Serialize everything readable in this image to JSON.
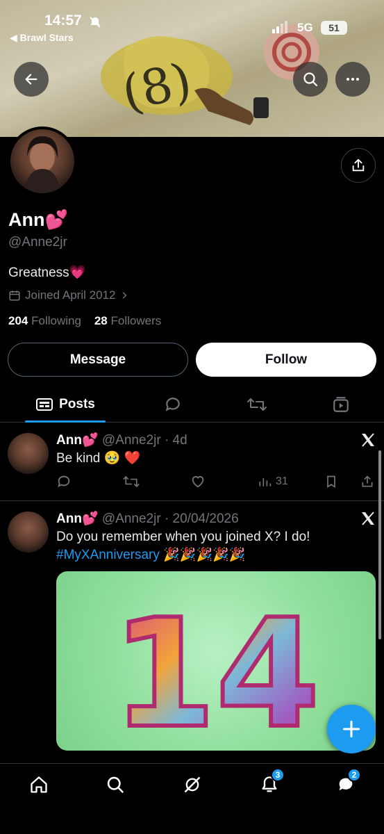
{
  "status_bar": {
    "time": "14:57",
    "back_app": "◀ Brawl Stars",
    "network": "5G",
    "battery": "51"
  },
  "profile": {
    "name": "Ann",
    "name_emoji": "💕",
    "handle": "@Anne2jr",
    "bio": "Greatness",
    "bio_emoji": "💗",
    "joined": "Joined April 2012",
    "following_count": "204",
    "following_label": "Following",
    "followers_count": "28",
    "followers_label": "Followers"
  },
  "actions": {
    "message_label": "Message",
    "follow_label": "Follow"
  },
  "tabs": {
    "posts_label": "Posts"
  },
  "posts": [
    {
      "name": "Ann",
      "name_emoji": "💕",
      "meta": "@Anne2jr · 4d",
      "text": "Be kind 🥹 ❤️",
      "views": "31"
    },
    {
      "name": "Ann",
      "name_emoji": "💕",
      "meta": "@Anne2jr · 20/04/2026",
      "text": "Do you remember when you joined X? I do!",
      "hashtag": "#MyXAnniversary",
      "emojis": "🎉🎉🎉🎉🎉",
      "media_number": "14"
    }
  ],
  "bottom_nav": {
    "notifications_badge": "3",
    "messages_badge": "2"
  },
  "colors": {
    "accent": "#1d9bf0",
    "background": "#000000",
    "muted_text": "#71767b"
  },
  "icons": [
    "back-arrow-icon",
    "search-icon",
    "more-icon",
    "share-icon",
    "calendar-icon",
    "chevron-right-icon",
    "posts-icon",
    "replies-icon",
    "reposts-icon",
    "media-icon",
    "x-logo-icon",
    "reply-icon",
    "repost-icon",
    "like-icon",
    "views-icon",
    "bookmark-icon",
    "plus-icon",
    "home-icon",
    "grok-icon",
    "bell-icon",
    "messages-icon"
  ]
}
